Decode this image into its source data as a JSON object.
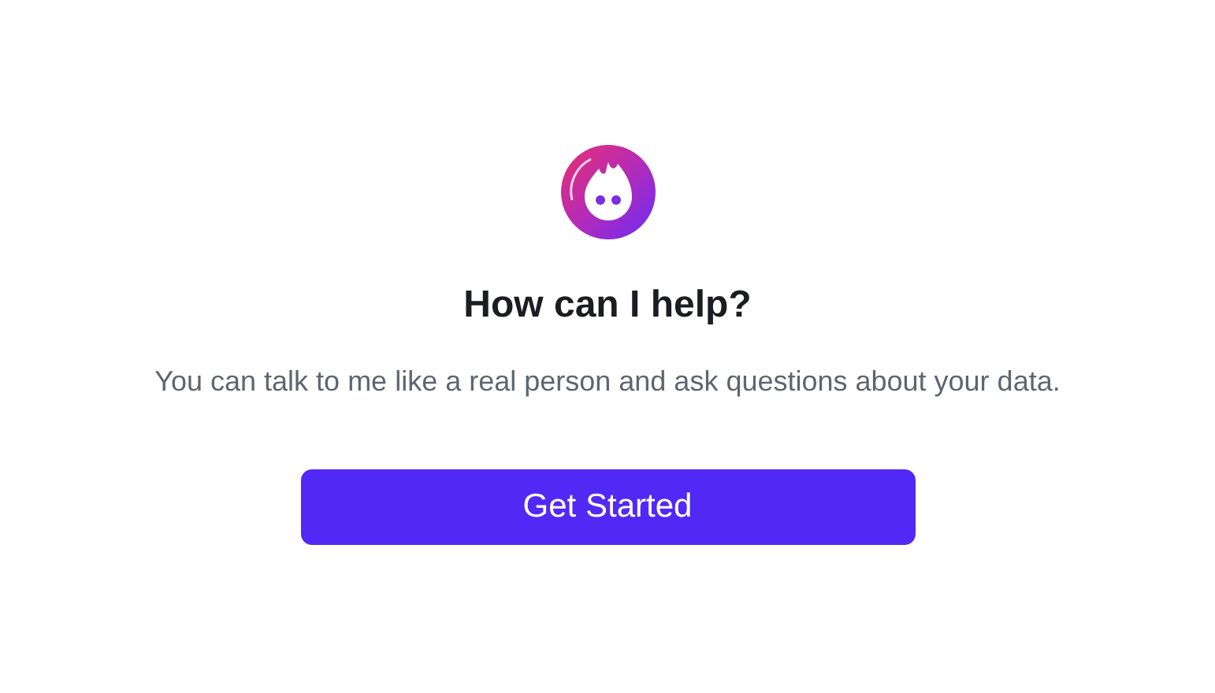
{
  "heading": "How can I help?",
  "description": "You can talk to me like a real person and ask questions about your data.",
  "button": "Get Started"
}
